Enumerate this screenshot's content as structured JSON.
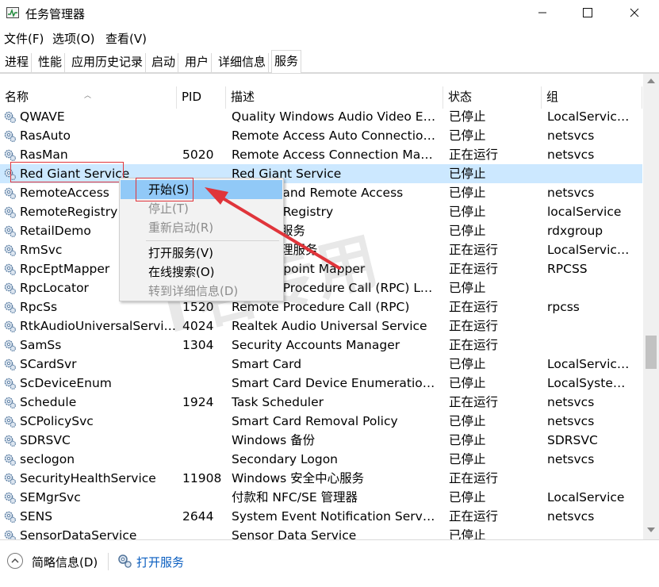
{
  "window": {
    "title": "任务管理器"
  },
  "menu": [
    "文件(F)",
    "选项(O)",
    "查看(V)"
  ],
  "tabs": [
    "进程",
    "性能",
    "应用历史记录",
    "启动",
    "用户",
    "详细信息",
    "服务"
  ],
  "active_tab": "服务",
  "columns": {
    "name": "名称",
    "pid": "PID",
    "desc": "描述",
    "status": "状态",
    "group": "组"
  },
  "services": [
    {
      "name": "QWAVE",
      "pid": "",
      "desc": "Quality Windows Audio Video Exp...",
      "status": "已停止",
      "group": "LocalService..."
    },
    {
      "name": "RasAuto",
      "pid": "",
      "desc": "Remote Access Auto Connection ...",
      "status": "已停止",
      "group": "netsvcs"
    },
    {
      "name": "RasMan",
      "pid": "5020",
      "desc": "Remote Access Connection Mana...",
      "status": "正在运行",
      "group": "netsvcs"
    },
    {
      "name": "Red Giant Service",
      "pid": "",
      "desc": "Red Giant Service",
      "status": "已停止",
      "group": "",
      "selected": true
    },
    {
      "name": "RemoteAccess",
      "pid": "",
      "desc": "Routing and Remote Access",
      "status": "已停止",
      "group": "netsvcs"
    },
    {
      "name": "RemoteRegistry",
      "pid": "",
      "desc": "Remote Registry",
      "status": "已停止",
      "group": "localService"
    },
    {
      "name": "RetailDemo",
      "pid": "",
      "desc": "零售演示服务",
      "status": "已停止",
      "group": "rdxgroup"
    },
    {
      "name": "RmSvc",
      "pid": "",
      "desc": "无线电管理服务",
      "status": "正在运行",
      "group": "LocalService..."
    },
    {
      "name": "RpcEptMapper",
      "pid": "",
      "desc": "RPC Endpoint Mapper",
      "status": "正在运行",
      "group": "RPCSS"
    },
    {
      "name": "RpcLocator",
      "pid": "",
      "desc": "Remote Procedure Call (RPC) Loc...",
      "status": "已停止",
      "group": ""
    },
    {
      "name": "RpcSs",
      "pid": "1520",
      "desc": "Remote Procedure Call (RPC)",
      "status": "正在运行",
      "group": "rpcss"
    },
    {
      "name": "RtkAudioUniversalService",
      "pid": "4024",
      "desc": "Realtek Audio Universal Service",
      "status": "正在运行",
      "group": ""
    },
    {
      "name": "SamSs",
      "pid": "1304",
      "desc": "Security Accounts Manager",
      "status": "正在运行",
      "group": ""
    },
    {
      "name": "SCardSvr",
      "pid": "",
      "desc": "Smart Card",
      "status": "已停止",
      "group": "LocalService..."
    },
    {
      "name": "ScDeviceEnum",
      "pid": "",
      "desc": "Smart Card Device Enumeration S...",
      "status": "已停止",
      "group": "LocalSystem..."
    },
    {
      "name": "Schedule",
      "pid": "1924",
      "desc": "Task Scheduler",
      "status": "正在运行",
      "group": "netsvcs"
    },
    {
      "name": "SCPolicySvc",
      "pid": "",
      "desc": "Smart Card Removal Policy",
      "status": "已停止",
      "group": "netsvcs"
    },
    {
      "name": "SDRSVC",
      "pid": "",
      "desc": "Windows 备份",
      "status": "已停止",
      "group": "SDRSVC"
    },
    {
      "name": "seclogon",
      "pid": "",
      "desc": "Secondary Logon",
      "status": "已停止",
      "group": "netsvcs"
    },
    {
      "name": "SecurityHealthService",
      "pid": "11908",
      "desc": "Windows 安全中心服务",
      "status": "正在运行",
      "group": ""
    },
    {
      "name": "SEMgrSvc",
      "pid": "",
      "desc": "付款和 NFC/SE 管理器",
      "status": "已停止",
      "group": "LocalService"
    },
    {
      "name": "SENS",
      "pid": "2644",
      "desc": "System Event Notification Service",
      "status": "正在运行",
      "group": "netsvcs"
    },
    {
      "name": "SensorDataService",
      "pid": "",
      "desc": "Sensor Data Service",
      "status": "已停止",
      "group": ""
    }
  ],
  "context_menu": [
    {
      "label": "开始(S)",
      "state": "highlighted"
    },
    {
      "label": "停止(T)",
      "state": "disabled"
    },
    {
      "label": "重新启动(R)",
      "state": "disabled"
    },
    {
      "label": "打开服务(V)",
      "state": "normal"
    },
    {
      "label": "在线搜索(O)",
      "state": "normal"
    },
    {
      "label": "转到详细信息(D)",
      "state": "disabled"
    }
  ],
  "footer": {
    "fewer_details": "简略信息(D)",
    "open_services": "打开服务"
  },
  "watermark": "T名专用",
  "colors": {
    "selection": "#cce8ff",
    "menu_highlight": "#91c9f7",
    "annotation_red": "#e0353b",
    "link": "#0a5ec0"
  }
}
